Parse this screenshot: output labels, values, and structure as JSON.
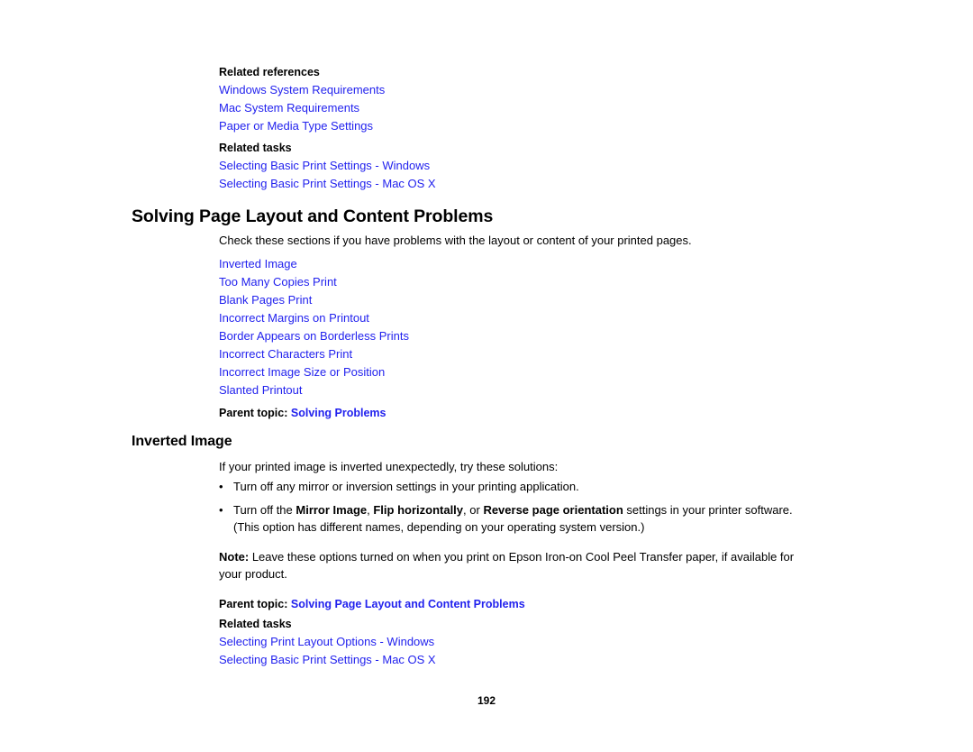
{
  "document": {
    "page_number": "192",
    "link_color": "#2222ee",
    "text_color": "#000000",
    "background": "#ffffff"
  },
  "top_related": {
    "references_label": "Related references",
    "reference_links": [
      "Windows System Requirements",
      "Mac System Requirements",
      "Paper or Media Type Settings"
    ],
    "tasks_label": "Related tasks",
    "task_links": [
      "Selecting Basic Print Settings - Windows",
      "Selecting Basic Print Settings - Mac OS X"
    ]
  },
  "section": {
    "title": "Solving Page Layout and Content Problems",
    "intro": "Check these sections if you have problems with the layout or content of your printed pages.",
    "topic_links": [
      "Inverted Image",
      "Too Many Copies Print",
      "Blank Pages Print",
      "Incorrect Margins on Printout",
      "Border Appears on Borderless Prints",
      "Incorrect Characters Print",
      "Incorrect Image Size or Position",
      "Slanted Printout"
    ],
    "parent_topic_label": "Parent topic:",
    "parent_topic_link": "Solving Problems"
  },
  "subsection": {
    "title": "Inverted Image",
    "intro": "If your printed image is inverted unexpectedly, try these solutions:",
    "bullet_marker": "•",
    "bullets": [
      {
        "parts": [
          {
            "text": "Turn off any mirror or inversion settings in your printing application.",
            "bold": false
          }
        ]
      },
      {
        "parts": [
          {
            "text": "Turn off the ",
            "bold": false
          },
          {
            "text": "Mirror Image",
            "bold": true
          },
          {
            "text": ", ",
            "bold": false
          },
          {
            "text": "Flip horizontally",
            "bold": true
          },
          {
            "text": ", or ",
            "bold": false
          },
          {
            "text": "Reverse page orientation",
            "bold": true
          },
          {
            "text": " settings in your printer software. (This option has different names, depending on your operating system version.)",
            "bold": false
          }
        ]
      }
    ],
    "note_label": "Note:",
    "note_text": " Leave these options turned on when you print on Epson Iron-on Cool Peel Transfer paper, if available for your product.",
    "parent_topic_label": "Parent topic:",
    "parent_topic_link": "Solving Page Layout and Content Problems",
    "related_tasks_label": "Related tasks",
    "related_task_links": [
      "Selecting Print Layout Options - Windows",
      "Selecting Basic Print Settings - Mac OS X"
    ]
  }
}
